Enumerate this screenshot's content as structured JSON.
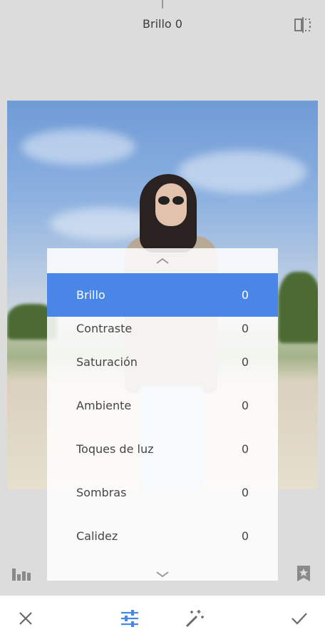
{
  "header": {
    "title": "Brillo 0"
  },
  "adjustments": {
    "items": [
      {
        "label": "Brillo",
        "value": "0"
      },
      {
        "label": "Contraste",
        "value": "0"
      },
      {
        "label": "Saturación",
        "value": "0"
      },
      {
        "label": "Ambiente",
        "value": "0"
      },
      {
        "label": "Toques de luz",
        "value": "0"
      },
      {
        "label": "Sombras",
        "value": "0"
      },
      {
        "label": "Calidez",
        "value": "0"
      }
    ],
    "selected": "Brillo"
  },
  "colors": {
    "accent": "#4a86e8",
    "icon_gray": "#7a7a7a"
  },
  "icons": {
    "compare": "compare-icon",
    "histogram": "histogram-icon",
    "styles": "bookmark-star-icon",
    "cancel": "close-icon",
    "adjust": "sliders-icon",
    "auto": "magic-wand-icon",
    "apply": "checkmark-icon"
  }
}
